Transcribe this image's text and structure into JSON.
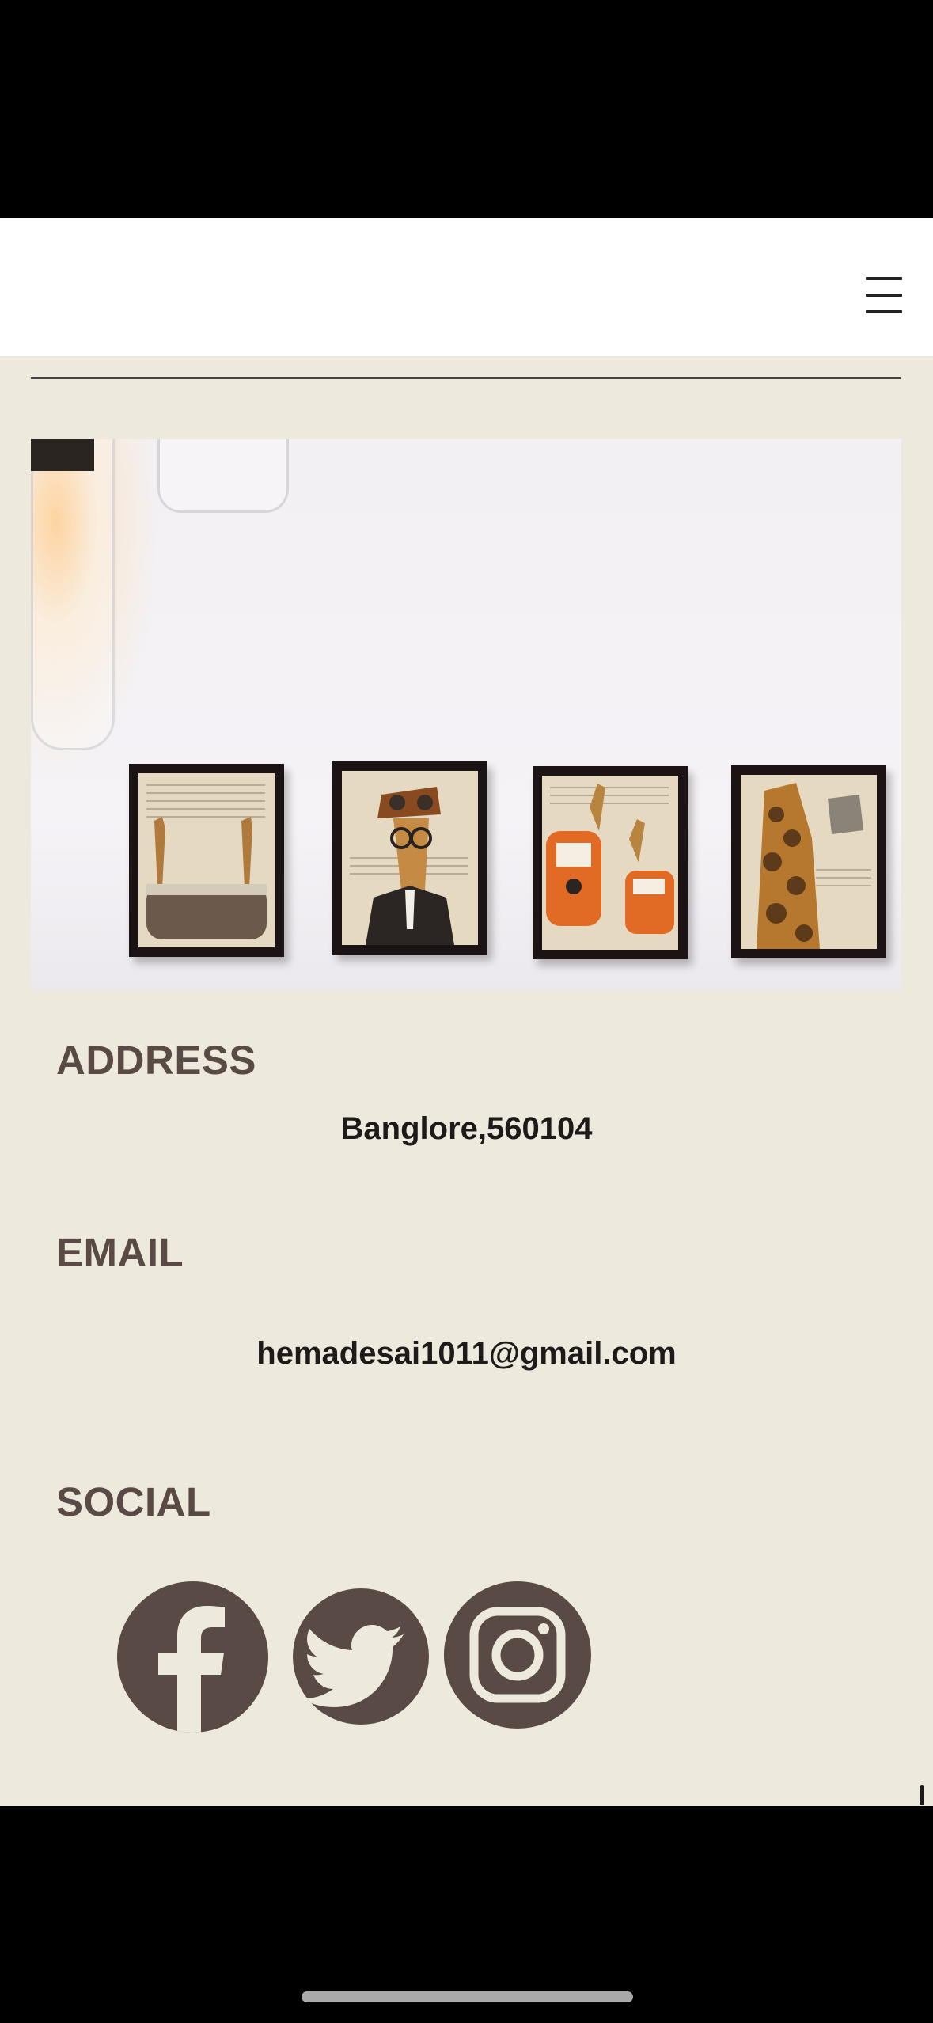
{
  "header": {
    "menu_icon": "hamburger-menu-icon"
  },
  "hero_image": {
    "alt": ""
  },
  "contact": {
    "address_label": "ADDRESS",
    "address_value": "Banglore,560104",
    "email_label": "EMAIL",
    "email_value": "hemadesai1011@gmail.com",
    "social_label": "SOCIAL"
  },
  "social_links": [
    {
      "icon": "facebook-icon"
    },
    {
      "icon": "twitter-icon"
    },
    {
      "icon": "instagram-icon"
    }
  ],
  "colors": {
    "page_bg": "#ede9dd",
    "accent": "#5a4a45",
    "text": "#1e1a1a",
    "header_bg": "#ffffff"
  }
}
